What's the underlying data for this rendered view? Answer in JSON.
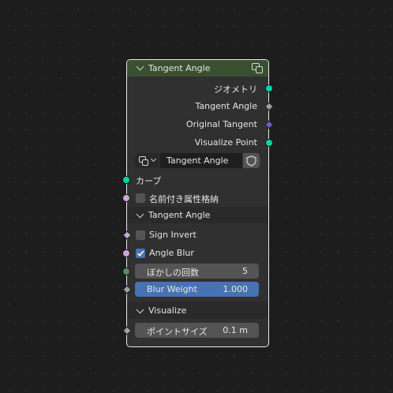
{
  "node": {
    "title": "Tangent Angle",
    "outputs": [
      {
        "label": "ジオメトリ",
        "color": "#00d6a3",
        "shape": "circle"
      },
      {
        "label": "Tangent Angle",
        "color": "#a1a1a1",
        "shape": "diamond"
      },
      {
        "label": "Original Tangent",
        "color": "#6363c7",
        "shape": "diamond"
      },
      {
        "label": "Visualize Point",
        "color": "#00d6a3",
        "shape": "circle"
      }
    ],
    "group_selector": {
      "value": "Tangent Angle"
    },
    "inputs": {
      "curve_label": "カーブ",
      "named_attr_label": "名前付き属性格納",
      "section_tangent": "Tangent Angle",
      "sign_invert": {
        "label": "Sign Invert",
        "checked": false
      },
      "angle_blur": {
        "label": "Angle Blur",
        "checked": true
      },
      "blur_count": {
        "label": "ぼかしの回数",
        "value": "5"
      },
      "blur_weight": {
        "label": "Blur Weight",
        "value": "1.000"
      },
      "section_visualize": "Visualize",
      "point_size": {
        "label": "ポイントサイズ",
        "value": "0.1 m"
      }
    }
  }
}
